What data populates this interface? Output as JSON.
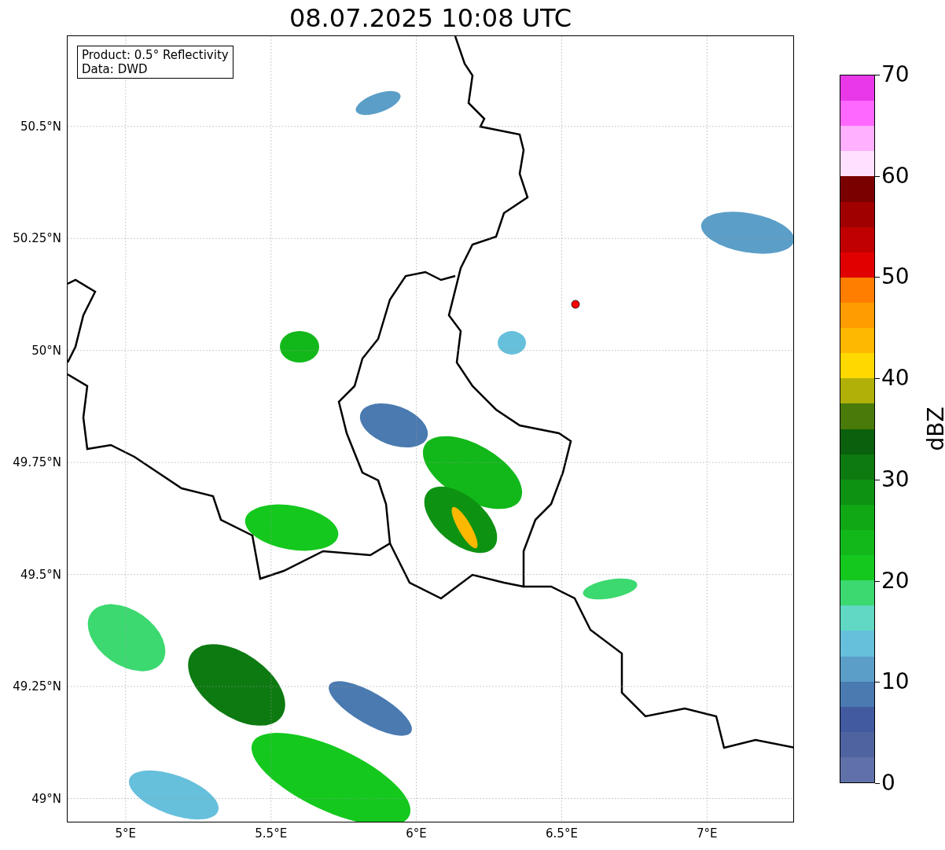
{
  "title": "08.07.2025 10:08 UTC",
  "map": {
    "legend": [
      "Product: 0.5° Reflectivity",
      "Data: DWD"
    ],
    "yticks": [
      "50.5°N",
      "50.25°N",
      "50°N",
      "49.75°N",
      "49.5°N",
      "49.25°N",
      "49°N"
    ],
    "xticks": [
      "5°E",
      "5.5°E",
      "6°E",
      "6.5°E",
      "7°E"
    ]
  },
  "colorbar": {
    "label": "dBZ",
    "ticks": [
      "70",
      "60",
      "50",
      "40",
      "30",
      "20",
      "10",
      "0"
    ],
    "bins": [
      {
        "color": "#e838e8"
      },
      {
        "color": "#ff68ff"
      },
      {
        "color": "#ffb0ff"
      },
      {
        "color": "#ffe0ff"
      },
      {
        "color": "#7a0000"
      },
      {
        "color": "#a00000"
      },
      {
        "color": "#c00000"
      },
      {
        "color": "#e00000"
      },
      {
        "color": "#ff7e00"
      },
      {
        "color": "#ff9c00"
      },
      {
        "color": "#ffb800"
      },
      {
        "color": "#ffd800"
      },
      {
        "color": "#b0b008"
      },
      {
        "color": "#4a7a0a"
      },
      {
        "color": "#0a600c"
      },
      {
        "color": "#0c7a10"
      },
      {
        "color": "#0e9212"
      },
      {
        "color": "#10a814"
      },
      {
        "color": "#12b81a"
      },
      {
        "color": "#14c81e"
      },
      {
        "color": "#3cd870"
      },
      {
        "color": "#60d8c4"
      },
      {
        "color": "#66c0dc"
      },
      {
        "color": "#5b9ec8"
      },
      {
        "color": "#4a7ab0"
      },
      {
        "color": "#415aa0"
      },
      {
        "color": "#4f63a0"
      },
      {
        "color": "#6070a8"
      }
    ]
  }
}
